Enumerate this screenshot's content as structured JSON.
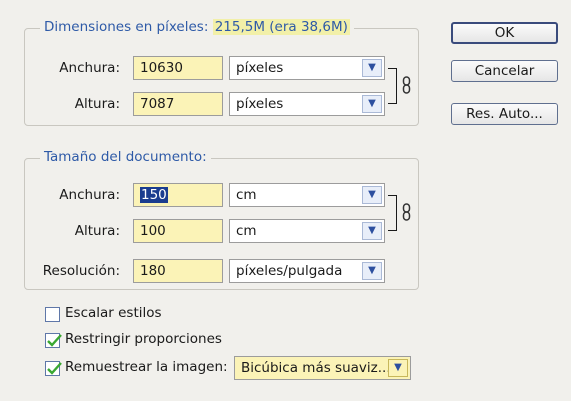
{
  "pixel_dimensions": {
    "legend_label": "Dimensiones en píxeles:",
    "legend_value": "215,5M (era 38,6M)",
    "width": {
      "label": "Anchura:",
      "value": "10630",
      "unit": "píxeles"
    },
    "height": {
      "label": "Altura:",
      "value": "7087",
      "unit": "píxeles"
    }
  },
  "document_size": {
    "legend": "Tamaño del documento:",
    "width": {
      "label": "Anchura:",
      "value": "150",
      "unit": "cm"
    },
    "height": {
      "label": "Altura:",
      "value": "100",
      "unit": "cm"
    },
    "resolution": {
      "label": "Resolución:",
      "value": "180",
      "unit": "píxeles/pulgada"
    }
  },
  "options": {
    "scale_styles": {
      "label": "Escalar estilos",
      "checked": false
    },
    "constrain": {
      "label": "Restringir proporciones",
      "checked": true
    },
    "resample": {
      "label": "Remuestrear la imagen:",
      "checked": true,
      "method": "Bicúbica más suaviz..."
    }
  },
  "buttons": {
    "ok": "OK",
    "cancel": "Cancelar",
    "auto": "Res. Auto..."
  },
  "icons": {
    "dropdown": "chevron-down-icon",
    "link": "chain-link-icon",
    "check": "checkmark-icon"
  },
  "colors": {
    "legend_text": "#2e5aa7",
    "field_bg": "#fbf3b7",
    "selection": "#1b3d8f",
    "check": "#3aa832"
  }
}
